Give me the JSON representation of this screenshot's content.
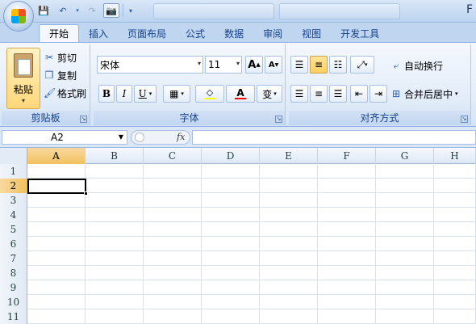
{
  "qat": {
    "save_icon": "save-icon",
    "undo_icon": "undo-icon",
    "redo_icon": "redo-icon",
    "camera_icon": "camera-icon",
    "customize_icon": "customize-qat-icon"
  },
  "title_partial": "F",
  "tabs": [
    "开始",
    "插入",
    "页面布局",
    "公式",
    "数据",
    "审阅",
    "视图",
    "开发工具"
  ],
  "active_tab": "开始",
  "clipboard": {
    "paste_label": "粘贴",
    "cut_label": "剪切",
    "copy_label": "复制",
    "format_painter_label": "格式刷",
    "group_label": "剪贴板"
  },
  "font": {
    "font_name": "宋体",
    "font_size": "11",
    "grow_label": "A",
    "shrink_label": "A",
    "bold_label": "B",
    "italic_label": "I",
    "underline_label": "U",
    "color_label": "A",
    "phonetic_label": "变",
    "group_label": "字体",
    "fill_color": "#ffff00",
    "font_color": "#ff0000"
  },
  "alignment": {
    "wrap_label": "自动换行",
    "merge_label": "合并后居中",
    "group_label": "对齐方式"
  },
  "formula_bar": {
    "name_box": "A2",
    "fx_label": "fx",
    "formula": ""
  },
  "sheet": {
    "columns": [
      "A",
      "B",
      "C",
      "D",
      "E",
      "F",
      "G",
      "H"
    ],
    "rows": [
      "1",
      "2",
      "3",
      "4",
      "5",
      "6",
      "7",
      "8",
      "9",
      "10",
      "11"
    ],
    "selected_column": "A",
    "selected_row": "2"
  },
  "colors": {
    "accent": "#15428b",
    "selection_header": "#f1c15f"
  }
}
